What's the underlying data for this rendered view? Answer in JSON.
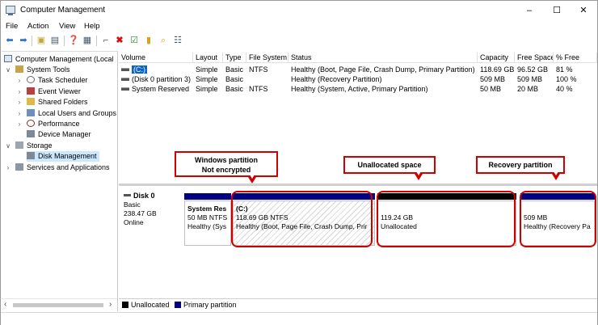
{
  "window": {
    "title": "Computer Management",
    "min": "–",
    "max": "☐",
    "close": "✕"
  },
  "menu": {
    "file": "File",
    "action": "Action",
    "view": "View",
    "help": "Help"
  },
  "tree": {
    "root": "Computer Management (Local",
    "system_tools": "System Tools",
    "task_scheduler": "Task Scheduler",
    "event_viewer": "Event Viewer",
    "shared_folders": "Shared Folders",
    "local_users": "Local Users and Groups",
    "performance": "Performance",
    "device_manager": "Device Manager",
    "storage": "Storage",
    "disk_management": "Disk Management",
    "services": "Services and Applications"
  },
  "columns": {
    "volume": "Volume",
    "layout": "Layout",
    "type": "Type",
    "fs": "File System",
    "status": "Status",
    "capacity": "Capacity",
    "free": "Free Space",
    "pct": "% Free"
  },
  "rows": [
    {
      "volume": "(C:)",
      "layout": "Simple",
      "type": "Basic",
      "fs": "NTFS",
      "status": "Healthy (Boot, Page File, Crash Dump, Primary Partition)",
      "capacity": "118.69 GB",
      "free": "96.52 GB",
      "pct": "81 %"
    },
    {
      "volume": "(Disk 0 partition 3)",
      "layout": "Simple",
      "type": "Basic",
      "fs": "",
      "status": "Healthy (Recovery Partition)",
      "capacity": "509 MB",
      "free": "509 MB",
      "pct": "100 %"
    },
    {
      "volume": "System Reserved",
      "layout": "Simple",
      "type": "Basic",
      "fs": "NTFS",
      "status": "Healthy (System, Active, Primary Partition)",
      "capacity": "50 MB",
      "free": "20 MB",
      "pct": "40 %"
    }
  ],
  "disk": {
    "name": "Disk 0",
    "kind": "Basic",
    "size": "238.47 GB",
    "state": "Online",
    "partitions": {
      "sysres": {
        "name": "System Res",
        "size": "50 MB NTFS",
        "status": "Healthy (Sys"
      },
      "c": {
        "name": "(C:)",
        "size": "118.69 GB NTFS",
        "status": "Healthy (Boot, Page File, Crash Dump, Prir"
      },
      "unalloc": {
        "size": "119.24 GB",
        "status": "Unallocated"
      },
      "recovery": {
        "size": "509 MB",
        "status": "Healthy (Recovery Pa"
      }
    }
  },
  "callouts": {
    "windows_line1": "Windows partition",
    "windows_line2": "Not encrypted",
    "unallocated": "Unallocated space",
    "recovery": "Recovery partition"
  },
  "legend": {
    "unallocated": "Unallocated",
    "primary": "Primary partition"
  },
  "colors": {
    "primary_bar": "#000080",
    "unallocated_bar": "#000000",
    "annotation": "#d00000",
    "selection": "#0a64c8"
  },
  "icons": [
    "computer-icon",
    "back-icon",
    "forward-icon",
    "folder-up-icon",
    "properties-icon",
    "help-icon",
    "connect-icon",
    "delete-icon",
    "check-icon",
    "folder-icon",
    "search-icon",
    "list-icon"
  ]
}
